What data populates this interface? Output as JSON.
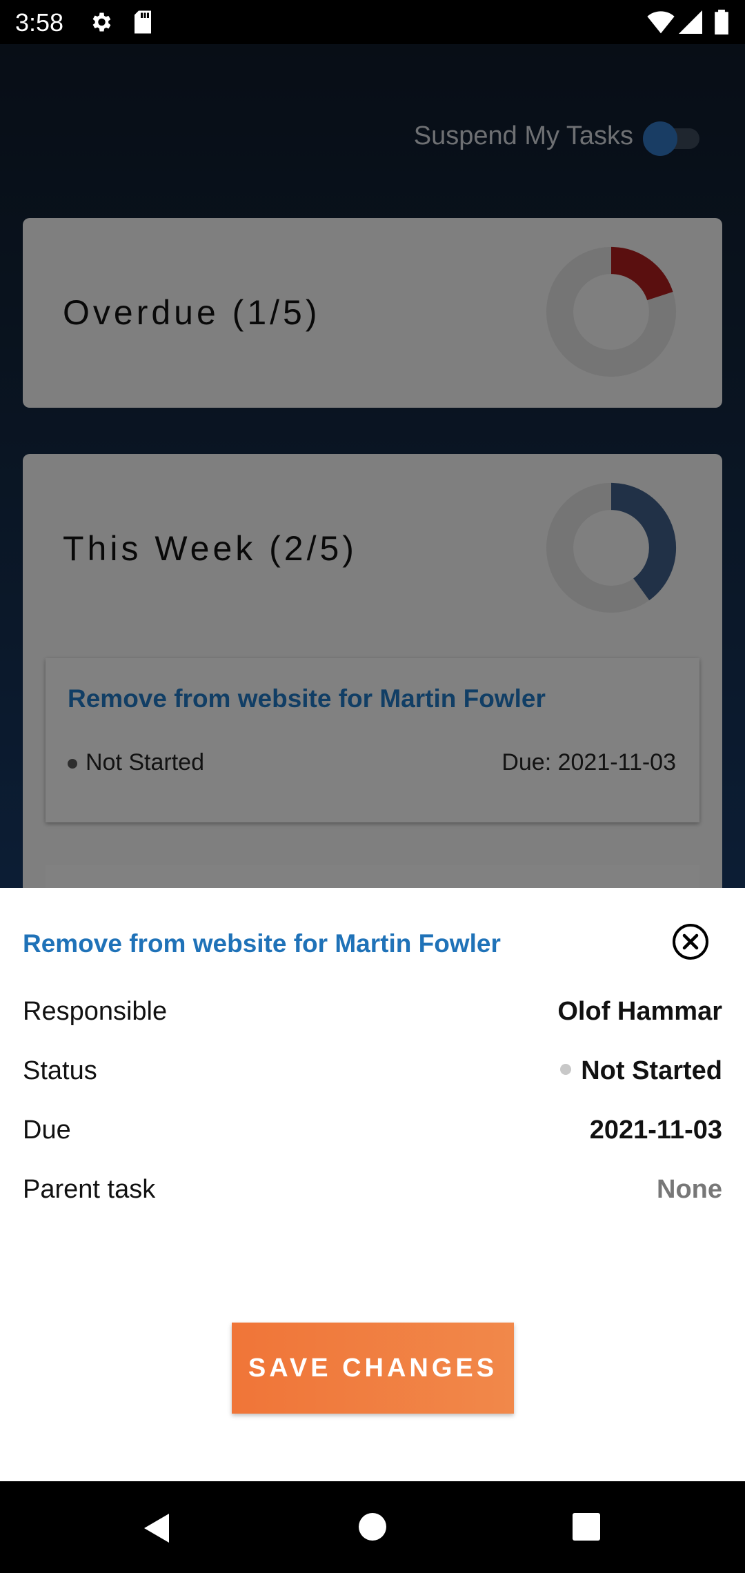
{
  "status_bar": {
    "time": "3:58",
    "icons": [
      "gear-icon",
      "sd-card-icon",
      "wifi-icon",
      "cell-signal-icon",
      "battery-icon"
    ]
  },
  "header": {
    "suspend_label": "Suspend My Tasks",
    "suspend_toggle": false
  },
  "sections": [
    {
      "title": "Overdue (1/5)",
      "donut_fraction": 0.2,
      "donut_color": "#a51d1d"
    },
    {
      "title": "This Week (2/5)",
      "donut_fraction": 0.4,
      "donut_color": "#3c5a82"
    }
  ],
  "task_card": {
    "title": "Remove from website for Martin Fowler",
    "status": "Not Started",
    "due": "Due: 2021-11-03"
  },
  "detail_sheet": {
    "title": "Remove from website for Martin Fowler",
    "rows": [
      {
        "label": "Responsible",
        "value": "Olof Hammar"
      },
      {
        "label": "Status",
        "value": "Not Started"
      },
      {
        "label": "Due",
        "value": "2021-11-03"
      },
      {
        "label": "Parent task",
        "value": "None"
      }
    ],
    "save_label": "SAVE CHANGES"
  },
  "colors": {
    "accent_blue": "#1f72b8",
    "save_orange": "#f07538",
    "overdue_red": "#a51d1d"
  },
  "nav_bar": {
    "icons": [
      "back-icon",
      "home-icon",
      "recents-icon"
    ]
  }
}
